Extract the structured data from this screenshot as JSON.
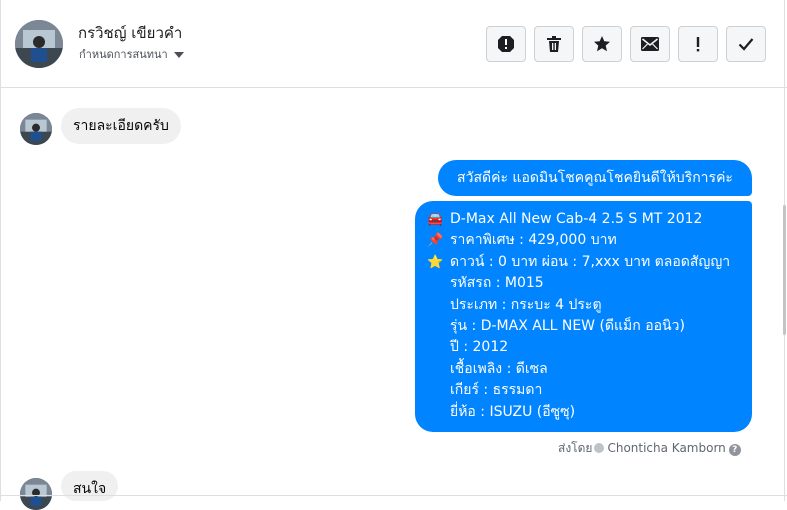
{
  "header": {
    "name": "กรวิชญ์ เขียวคำ",
    "subtitle": "กำหนดการสนทนา"
  },
  "toolbar": [
    {
      "name": "report-icon"
    },
    {
      "name": "trash-icon"
    },
    {
      "name": "star-icon"
    },
    {
      "name": "envelope-icon"
    },
    {
      "name": "exclamation-icon"
    },
    {
      "name": "check-icon"
    }
  ],
  "messages": {
    "incoming1": "รายละเอียดครับ",
    "outgoing1": "สวัสดีค่ะ แอดมินโชคคูณโชคยินดีให้บริการค่ะ",
    "car_details": [
      {
        "emoji": "🚘",
        "text": "D-Max All New Cab-4 2.5 S MT 2012"
      },
      {
        "emoji": "📌",
        "text": "ราคาพิเศษ : 429,000 บาท"
      },
      {
        "emoji": "⭐",
        "text": "ดาวน์ : 0 บาท ผ่อน : 7,xxx บาท ตลอดสัญญา"
      },
      {
        "emoji": "",
        "text": "รหัสรถ : M015"
      },
      {
        "emoji": "",
        "text": "ประเภท : กระบะ 4 ประตู"
      },
      {
        "emoji": "",
        "text": "รุ่น : D-MAX ALL NEW (ดีแม็ก ออนิว)"
      },
      {
        "emoji": "",
        "text": "ปี : 2012"
      },
      {
        "emoji": "",
        "text": "เชื้อเพลิง : ดีเซล"
      },
      {
        "emoji": "",
        "text": "เกียร์ : ธรรมดา"
      },
      {
        "emoji": "",
        "text": "ยี่ห้อ : ISUZU (อีซูซุ)"
      }
    ],
    "sent_by_label": "ส่งโดย",
    "sent_by_name": "Chonticha Kamborn",
    "incoming2_partial": "สนใจ"
  },
  "colors": {
    "outgoing_bubble": "#0084ff",
    "incoming_bubble": "#f0f0f0"
  }
}
